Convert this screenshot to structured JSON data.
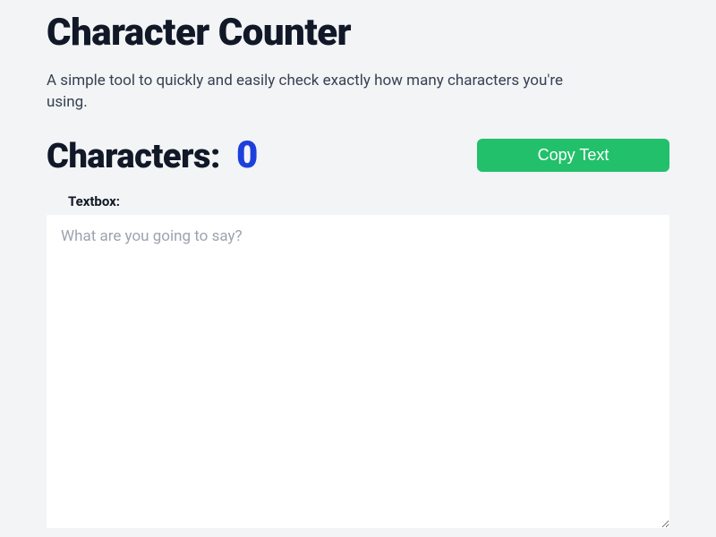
{
  "header": {
    "title": "Character Counter",
    "description": "A simple tool to quickly and easily check exactly how many characters you're using."
  },
  "counter": {
    "label": "Characters:",
    "value": "0"
  },
  "actions": {
    "copy_label": "Copy Text"
  },
  "textbox": {
    "label": "Textbox:",
    "placeholder": "What are you going to say?",
    "value": ""
  }
}
